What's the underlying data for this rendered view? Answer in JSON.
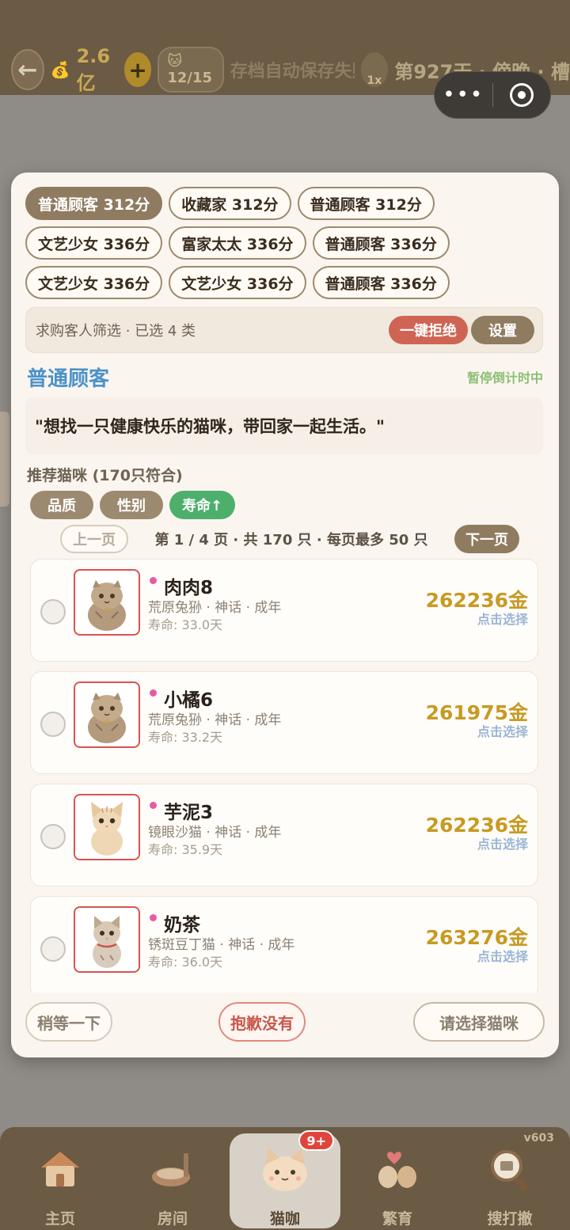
{
  "header": {
    "back_icon": "back-arrow-icon",
    "money": "2.6亿",
    "plus": "+",
    "cat_capacity": "🐱12/15",
    "ticker": "存档自动保存失败 · 上",
    "speed": "1x",
    "day": "第927天 · 傍晚 · 槽"
  },
  "capsule": {
    "menu": "•••",
    "close_icon": "target-icon"
  },
  "customers": [
    {
      "label": "普通顾客 312分",
      "active": true
    },
    {
      "label": "收藏家 312分",
      "active": false
    },
    {
      "label": "普通顾客 312分",
      "active": false
    },
    {
      "label": "文艺少女 336分",
      "active": false
    },
    {
      "label": "富家太太 336分",
      "active": false
    },
    {
      "label": "普通顾客 336分",
      "active": false
    },
    {
      "label": "文艺少女 336分",
      "active": false
    },
    {
      "label": "文艺少女 336分",
      "active": false
    },
    {
      "label": "普通顾客 336分",
      "active": false
    }
  ],
  "filter": {
    "text": "求购客人筛选 · 已选 4 类",
    "reject_label": "一键拒绝",
    "settings_label": "设置"
  },
  "customer": {
    "title": "普通顾客",
    "status": "暂停倒计时中",
    "quote": "\"想找一只健康快乐的猫咪，带回家一起生活。\""
  },
  "recommend": {
    "title": "推荐猫咪 (170只符合)",
    "sorts": [
      {
        "label": "品质",
        "active": false
      },
      {
        "label": "性别",
        "active": false
      },
      {
        "label": "寿命↑",
        "active": true
      }
    ]
  },
  "pager": {
    "prev_label": "上一页",
    "info": "第 1 / 4 页 · 共 170 只 · 每页最多 50 只",
    "next_label": "下一页"
  },
  "cats": [
    {
      "name": "肉肉8",
      "desc": "荒原兔狲 · 神话 · 成年",
      "life": "寿命: 33.0天",
      "price": "262236金",
      "pick": "点击选择",
      "kind": "manul"
    },
    {
      "name": "小橘6",
      "desc": "荒原兔狲 · 神话 · 成年",
      "life": "寿命: 33.2天",
      "price": "261975金",
      "pick": "点击选择",
      "kind": "manul"
    },
    {
      "name": "芋泥3",
      "desc": "镜眼沙猫 · 神话 · 成年",
      "life": "寿命: 35.9天",
      "price": "262236金",
      "pick": "点击选择",
      "kind": "sand"
    },
    {
      "name": "奶茶",
      "desc": "锈斑豆丁猫 · 神话 · 成年",
      "life": "寿命: 36.0天",
      "price": "263276金",
      "pick": "点击选择",
      "kind": "tabby"
    }
  ],
  "footer": {
    "wait_label": "稍等一下",
    "sorry_label": "抱歉没有",
    "choose_label": "请选择猫咪"
  },
  "nav": {
    "version": "v603",
    "items": [
      {
        "label": "主页",
        "icon": "house-icon"
      },
      {
        "label": "房间",
        "icon": "cat-bed-icon"
      },
      {
        "label": "猫咖",
        "icon": "cat-face-icon",
        "badge": "9+",
        "active": true
      },
      {
        "label": "繁育",
        "icon": "cat-couple-icon"
      },
      {
        "label": "搜打撤",
        "icon": "magnifier-icon"
      }
    ]
  },
  "colors": {
    "accent_brown": "#8f7b60",
    "reject_red": "#cf6455",
    "sort_green": "#4caf6c",
    "price_gold": "#c79a22",
    "title_blue": "#4b93c9"
  }
}
